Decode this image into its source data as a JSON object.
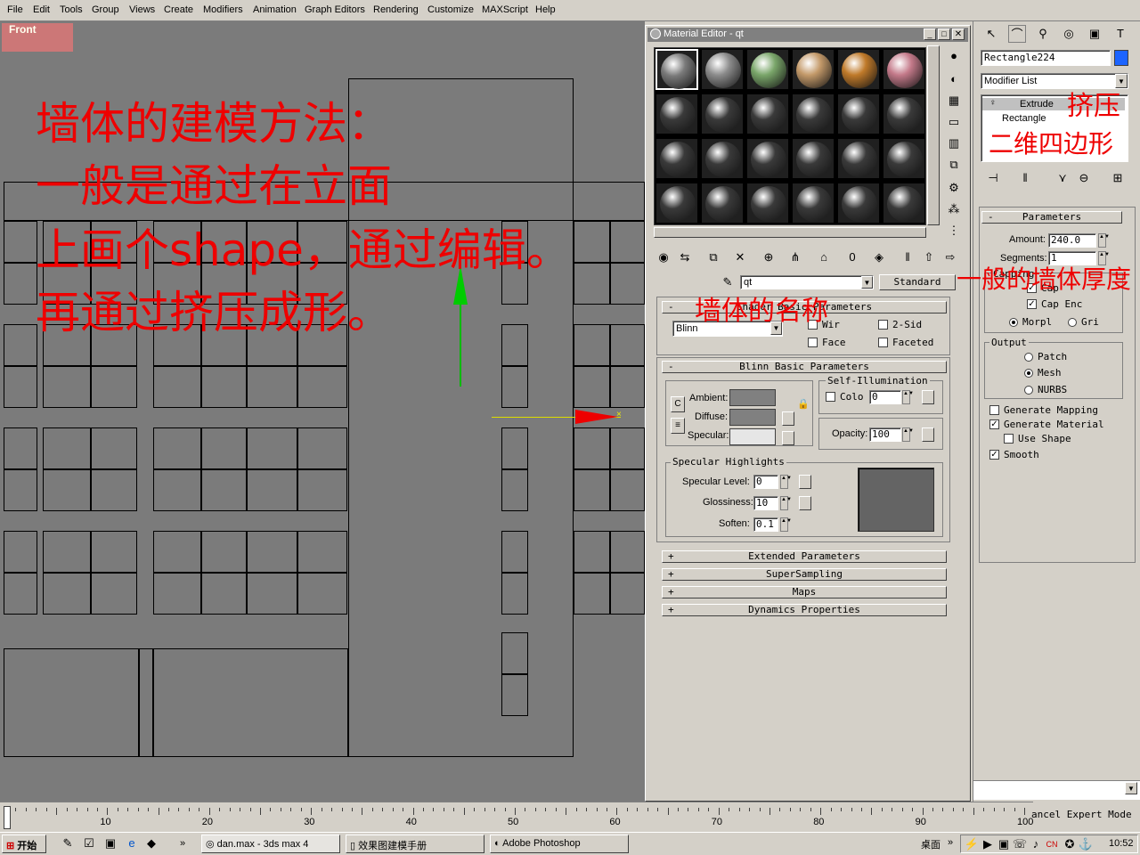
{
  "menu": [
    "File",
    "Edit",
    "Tools",
    "Group",
    "Views",
    "Create",
    "Modifiers",
    "Animation",
    "Graph Editors",
    "Rendering",
    "Customize",
    "MAXScript",
    "Help"
  ],
  "viewport": {
    "label": "Front"
  },
  "annotations": {
    "heading": "墙体的建模方法：",
    "line1": "一般是通过在立面",
    "line2": "上画个shape，通过编辑。",
    "line3": "再通过挤压成形。",
    "extrude_note": "挤压",
    "rectangle_note": "二维四边形",
    "wall_name_note": "墙体的名称",
    "thickness_note": "一般的墙体厚度"
  },
  "material_editor": {
    "title": "Material Editor - qt",
    "material_name": "qt",
    "material_type": "Standard",
    "spheres": [
      "#7a7a7a",
      "#8c8c8c",
      "#7aa66a",
      "#c49a6a",
      "#c07a2a",
      "#c47a8a",
      "#3a3a3a",
      "#3a3a3a",
      "#3a3a3a",
      "#3a3a3a",
      "#3a3a3a",
      "#3a3a3a",
      "#3a3a3a",
      "#3a3a3a",
      "#3a3a3a",
      "#3a3a3a",
      "#3a3a3a",
      "#3a3a3a",
      "#3a3a3a",
      "#3a3a3a",
      "#3a3a3a",
      "#3a3a3a",
      "#3a3a3a",
      "#3a3a3a"
    ],
    "shader_rollout": "Shader Basic Parameters",
    "shader": "Blinn",
    "wire": "Wir",
    "two_sided": "2-Sid",
    "face": "Face",
    "faceted": "Faceted",
    "blinn_rollout": "Blinn Basic Parameters",
    "self_illum": "Self-Illumination",
    "color_label": "Colo",
    "color_value": "0",
    "ambient": "Ambient:",
    "diffuse": "Diffuse:",
    "specular": "Specular:",
    "opacity_label": "Opacity:",
    "opacity_value": "100",
    "spec_highlights": "Specular Highlights",
    "spec_level_label": "Specular Level:",
    "spec_level": "0",
    "glossiness_label": "Glossiness:",
    "glossiness": "10",
    "soften_label": "Soften:",
    "soften": "0.1",
    "extended": "Extended Parameters",
    "supersampling": "SuperSampling",
    "maps": "Maps",
    "dynamics": "Dynamics Properties"
  },
  "command_panel": {
    "object_name": "Rectangle224",
    "object_color": "#1c64ff",
    "modifier_list": "Modifier List",
    "stack": [
      "Extrude",
      "Rectangle"
    ],
    "params_title": "Parameters",
    "amount_label": "Amount:",
    "amount": "240.0",
    "segments_label": "Segments:",
    "segments": "1",
    "capping": "Capping",
    "cap_start": "Cap",
    "cap_end": "Cap Enc",
    "morph": "Morpl",
    "grid": "Gri",
    "output": "Output",
    "patch": "Patch",
    "mesh": "Mesh",
    "nurbs": "NURBS",
    "gen_mapping": "Generate Mapping",
    "gen_material": "Generate Material",
    "use_shape": "Use Shape",
    "smooth": "Smooth"
  },
  "timeline": {
    "ticks": [
      "10",
      "20",
      "30",
      "40",
      "50",
      "60",
      "70",
      "80",
      "90",
      "100"
    ],
    "status": "ancel Expert Mode"
  },
  "taskbar": {
    "start": "开始",
    "tasks": [
      "dan.max - 3ds max 4",
      "效果图建模手册",
      "Adobe Photoshop"
    ],
    "desktop": "桌面",
    "clock": "10:52"
  }
}
